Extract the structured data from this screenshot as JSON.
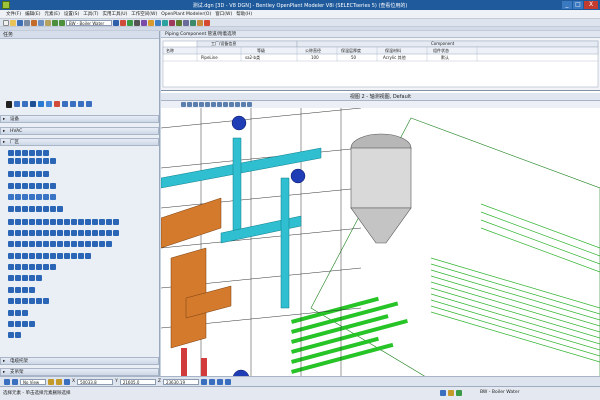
{
  "window": {
    "title": "测试.dgn [3D - V8 DGN] - Bentley OpenPlant Modeler V8i (SELECTseries 5) (查看位用的)",
    "minimize": "_",
    "maximize": "□",
    "close": "X"
  },
  "menu": [
    "文件(F)",
    "编辑(E)",
    "元素(E)",
    "设置(S)",
    "工具(T)",
    "实用工具(U)",
    "工作空间(W)",
    "OpenPlant Modeler(O)",
    "窗口(W)",
    "帮助(H)"
  ],
  "toolbar": {
    "model_combo": "BW - Boiler Water"
  },
  "left_panel": {
    "title": "任务",
    "sections": [
      "设备",
      "HVAC",
      "厂区",
      "电缆托架",
      "支吊架",
      "结构"
    ],
    "bottom_section": "图纸组织"
  },
  "piping_table": {
    "title": "Piping Component 管道/附着选项",
    "col_group_left": "工厂/设备信息",
    "col_group_right": "Component",
    "header_row": [
      "名称",
      "",
      "等级",
      "公称直径",
      "保温层厚度",
      "保温材料",
      "组件状态"
    ],
    "value_row": [
      "",
      "PipeLine",
      "sa2-b类",
      "100",
      "50",
      "Acrylic 其他",
      "默认"
    ]
  },
  "view": {
    "title": "视图 2 - 轴测视图, Default"
  },
  "accudraw": {
    "x_label": "X",
    "x_value": "50033.8",
    "y_label": "Y",
    "y_value": "21605.0",
    "z_label": "Z",
    "z_value": "23630.19",
    "view_combo": "No View"
  },
  "status": {
    "left": "选择元素 - 单击选择元素删除选择",
    "right": "BW - Boiler Water"
  }
}
